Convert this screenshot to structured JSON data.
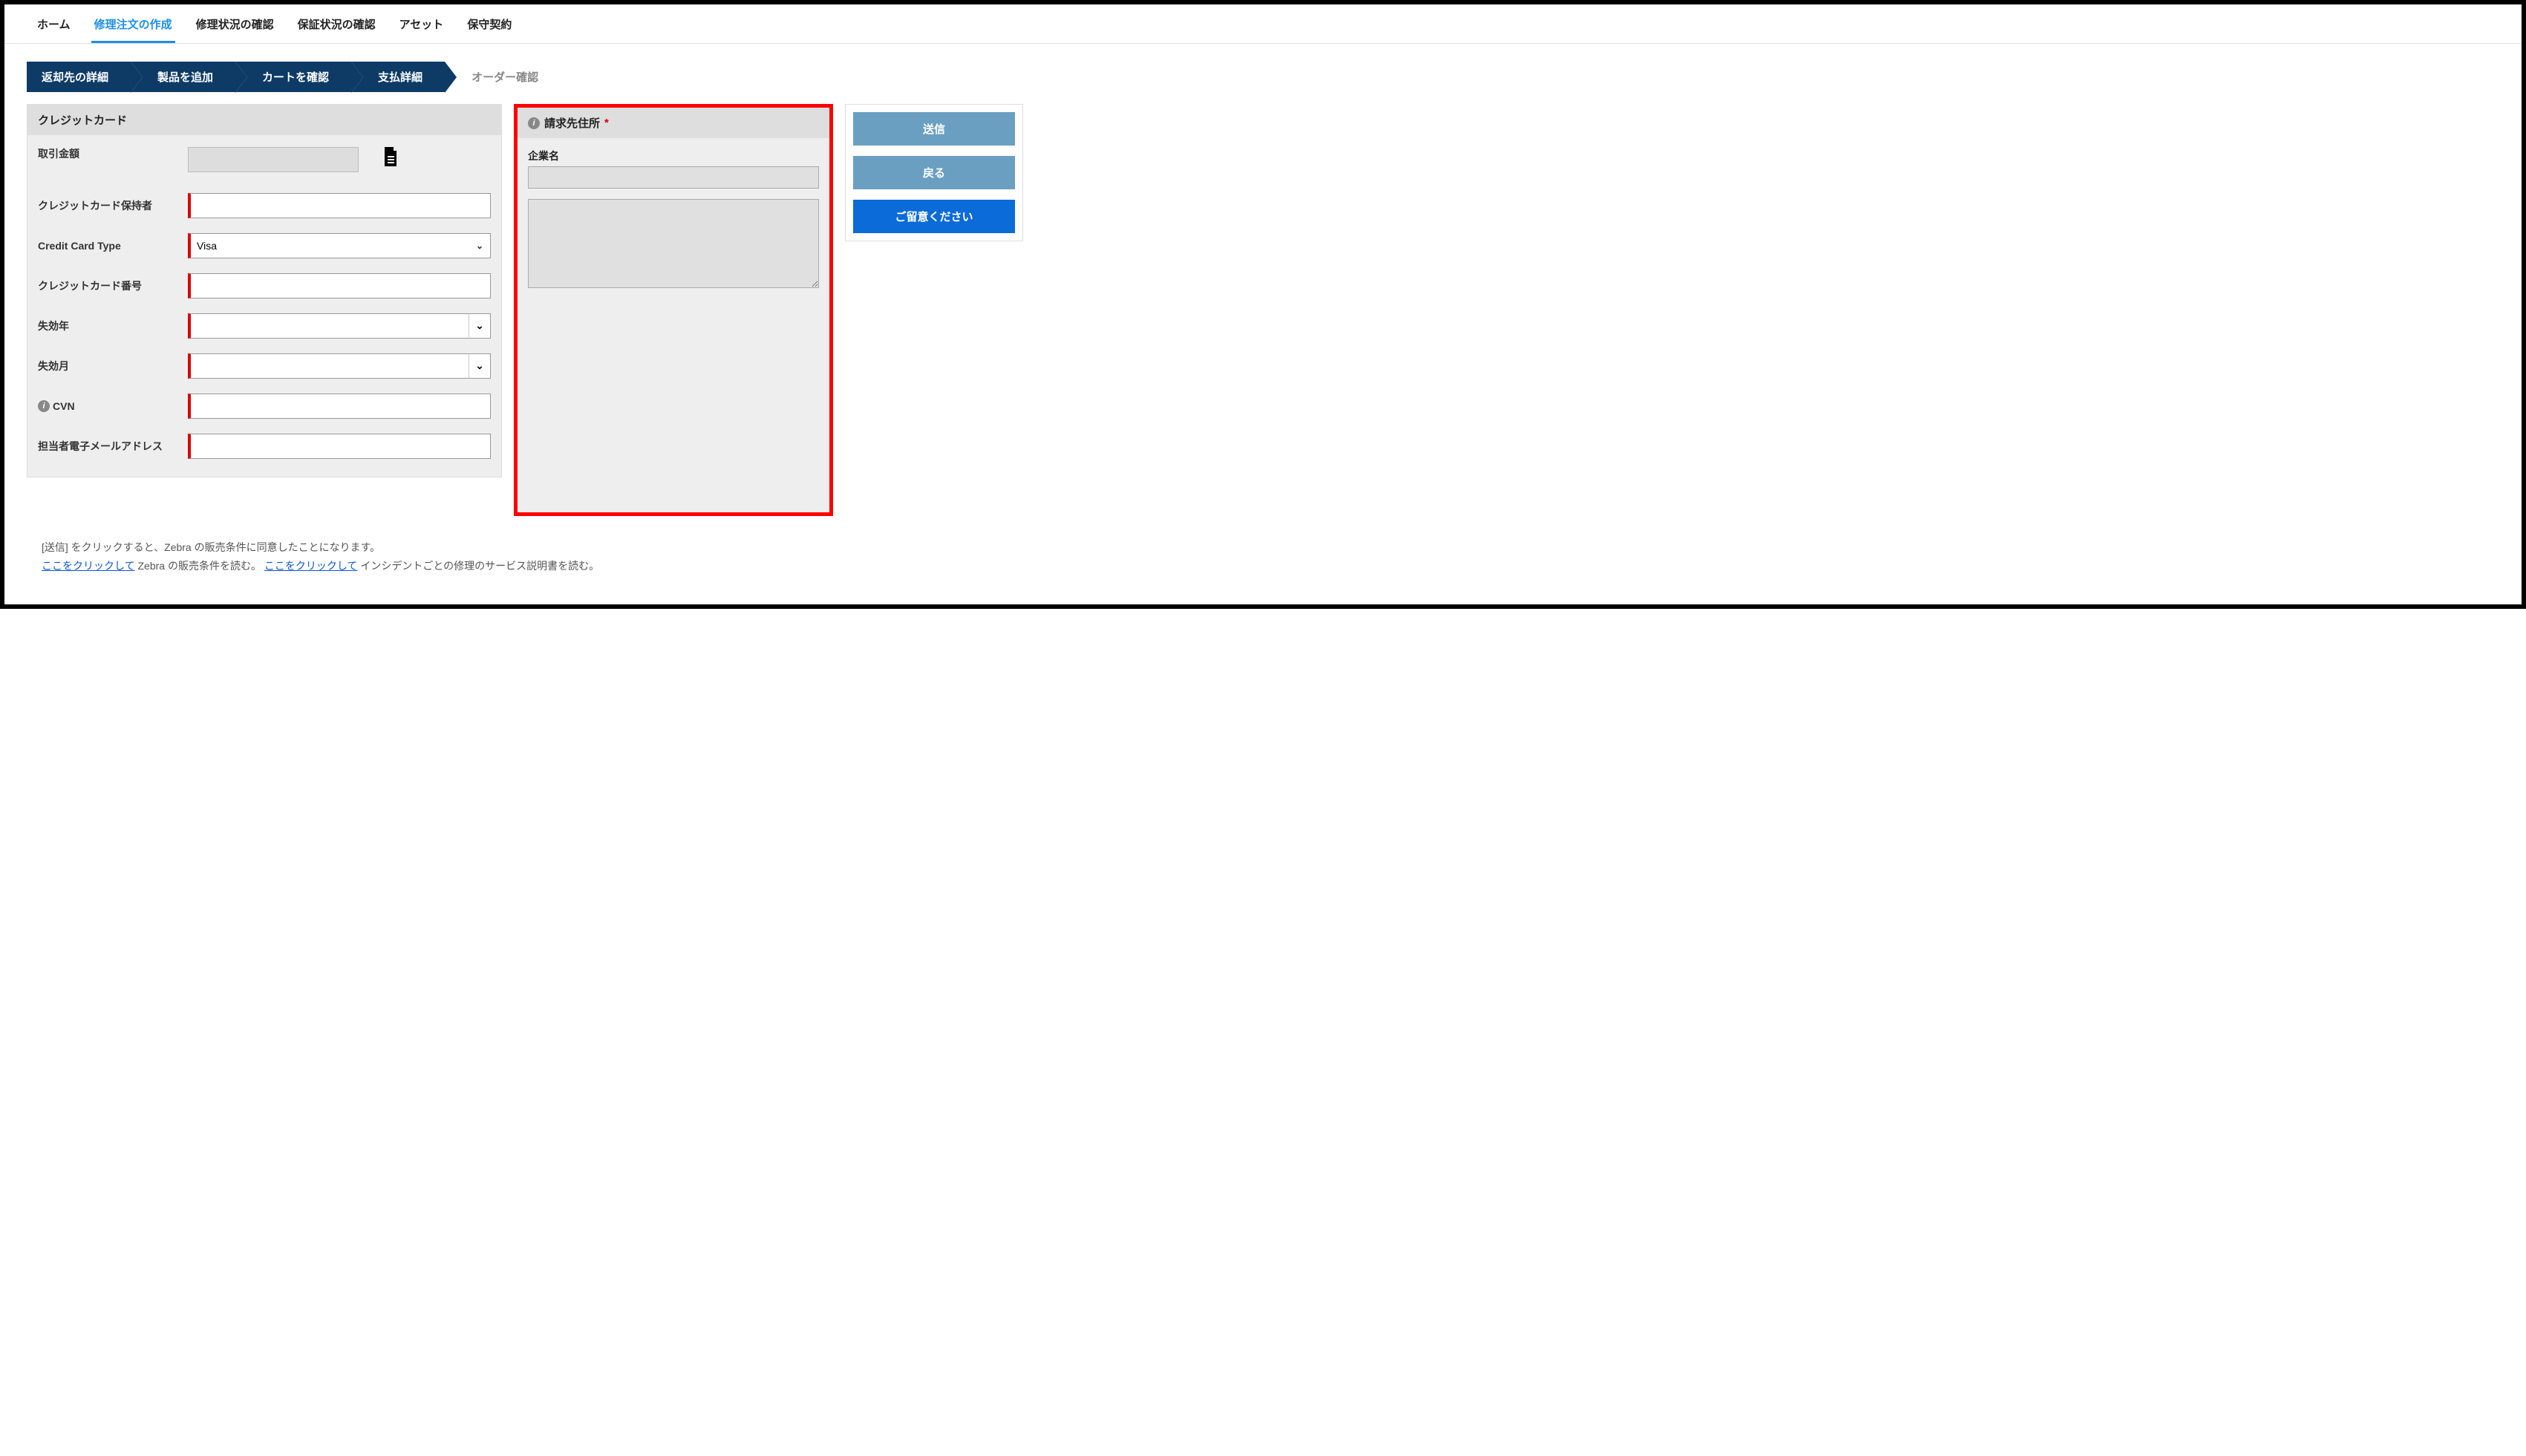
{
  "nav": {
    "home": "ホーム",
    "create": "修理注文の作成",
    "repair_status": "修理状況の確認",
    "warranty_status": "保証状況の確認",
    "asset": "アセット",
    "contract": "保守契約"
  },
  "steps": {
    "return": "返却先の詳細",
    "add_product": "製品を追加",
    "check_cart": "カートを確認",
    "payment": "支払詳細",
    "confirm": "オーダー確認"
  },
  "cc": {
    "header": "クレジットカード",
    "amount_label": "取引金額",
    "holder_label": "クレジットカード保持者",
    "type_label": "Credit Card Type",
    "type_value": "Visa",
    "number_label": "クレジットカード番号",
    "exp_year_label": "失効年",
    "exp_month_label": "失効月",
    "cvn_label": "CVN",
    "email_label": "担当者電子メールアドレス"
  },
  "billing": {
    "header": "請求先住所",
    "company_label": "企業名"
  },
  "actions": {
    "submit": "送信",
    "back": "戻る",
    "note": "ご留意ください"
  },
  "footer": {
    "line1_prefix": "[送信] をクリックすると、Zebra の販売条件に同意したことになります。",
    "link_text": "ここをクリックして",
    "line2_mid": " Zebra の販売条件を読む。 ",
    "line2_suffix": " インシデントごとの修理のサービス説明書を読む。"
  }
}
